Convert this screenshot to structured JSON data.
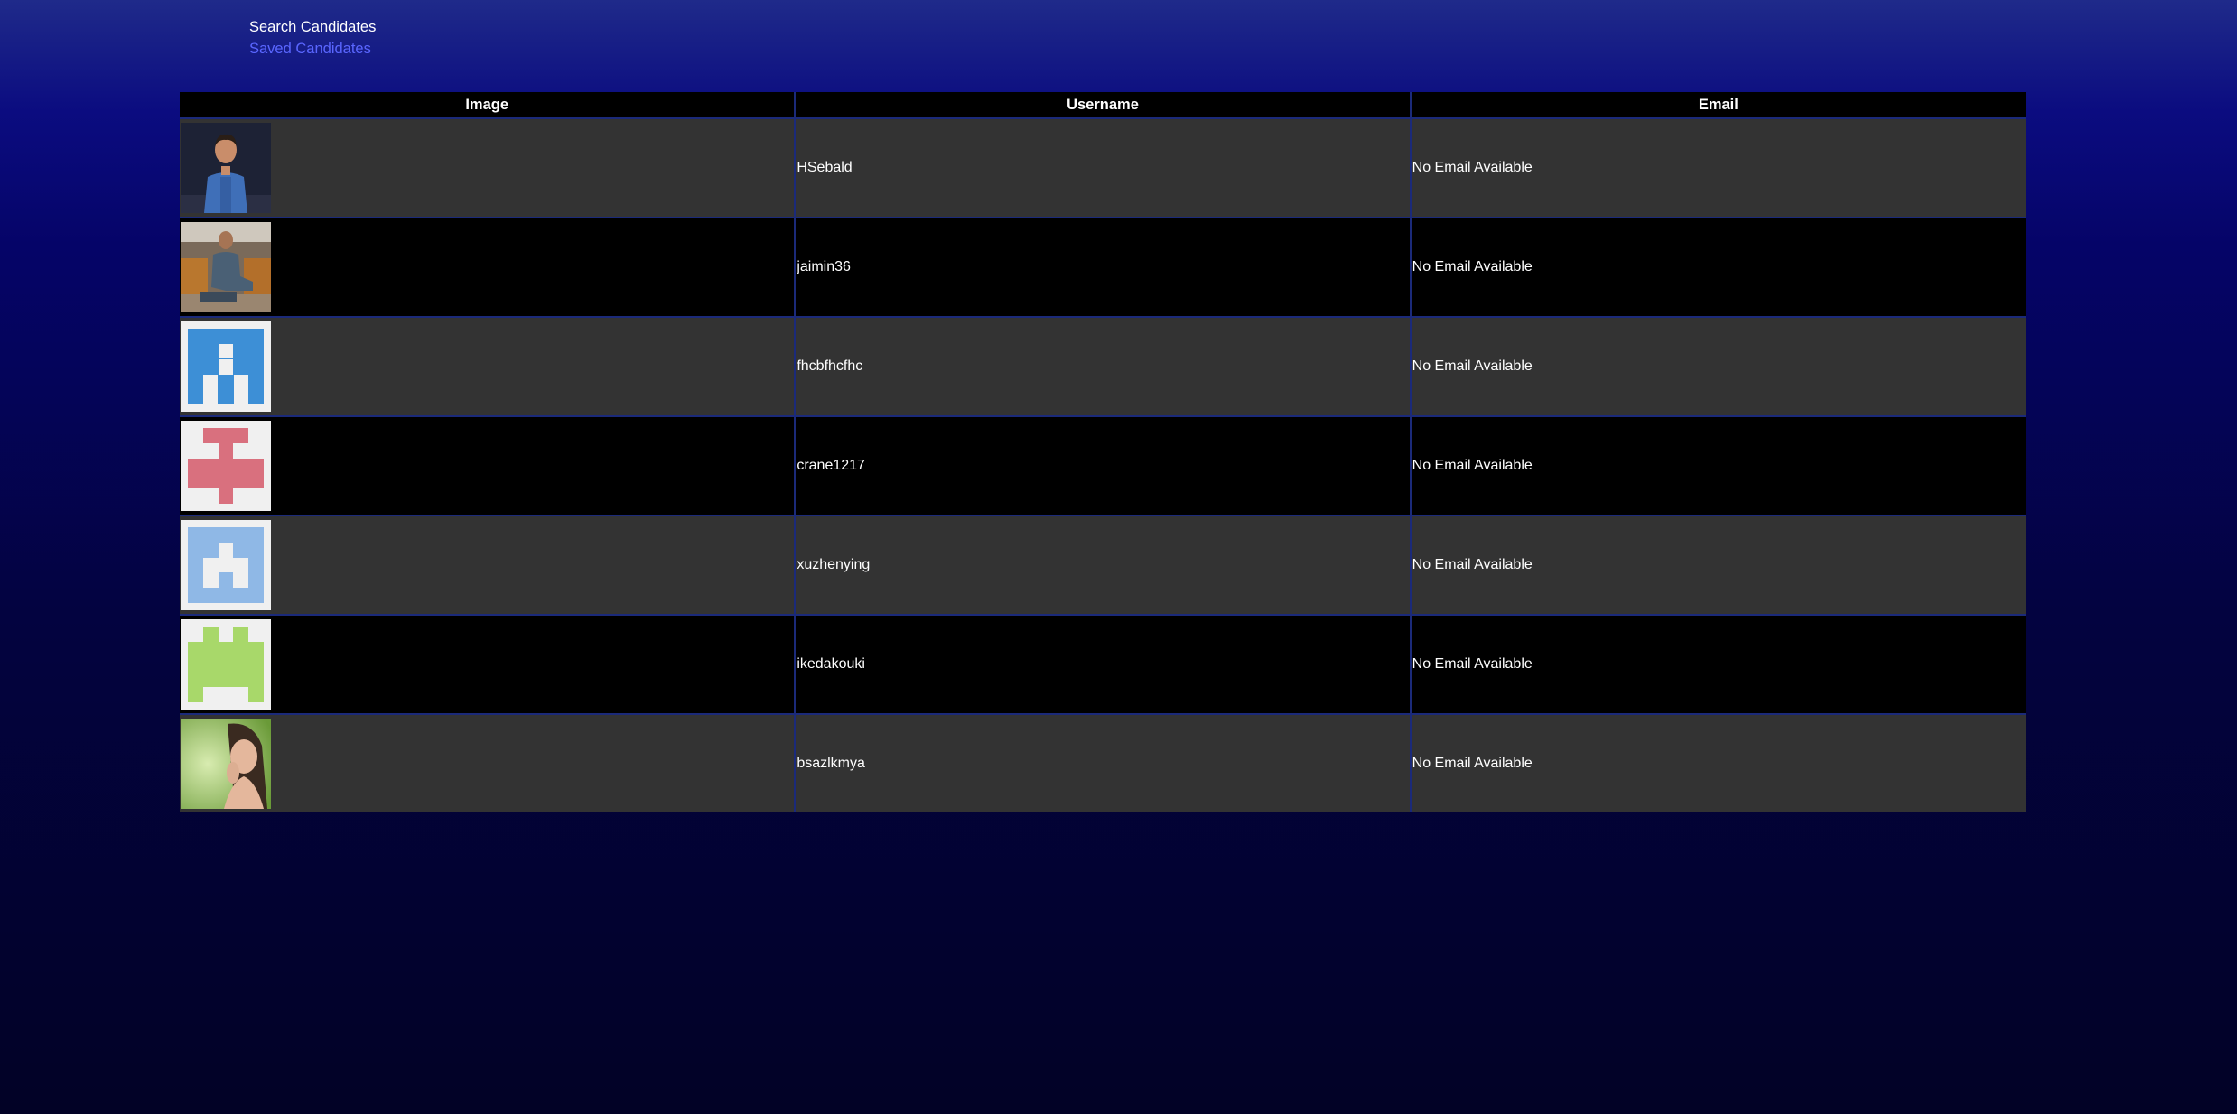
{
  "nav": {
    "search_label": "Search Candidates",
    "saved_label": "Saved Candidates"
  },
  "table": {
    "headers": [
      "Image",
      "Username",
      "Email"
    ],
    "rows": [
      {
        "avatar": "cartoon-man-avatar",
        "username": "HSebald",
        "email": "No Email Available"
      },
      {
        "avatar": "photo-man-sitting-avatar",
        "username": "jaimin36",
        "email": "No Email Available"
      },
      {
        "avatar": "identicon-blue-avatar",
        "username": "fhcbfhcfhc",
        "email": "No Email Available"
      },
      {
        "avatar": "identicon-pink-avatar",
        "username": "crane1217",
        "email": "No Email Available"
      },
      {
        "avatar": "identicon-lightblue-avatar",
        "username": "xuzhenying",
        "email": "No Email Available"
      },
      {
        "avatar": "identicon-green-avatar",
        "username": "ikedakouki",
        "email": "No Email Available"
      },
      {
        "avatar": "photo-woman-avatar",
        "username": "bsazlkmya",
        "email": "No Email Available"
      }
    ]
  },
  "colors": {
    "link_active": "#5a66ff",
    "row_dark": "#333333",
    "row_black": "#000000",
    "identicon_blue": "#3d8fd6",
    "identicon_pink": "#d9707e",
    "identicon_lightblue": "#8fb8e6",
    "identicon_green": "#a8d86a"
  }
}
